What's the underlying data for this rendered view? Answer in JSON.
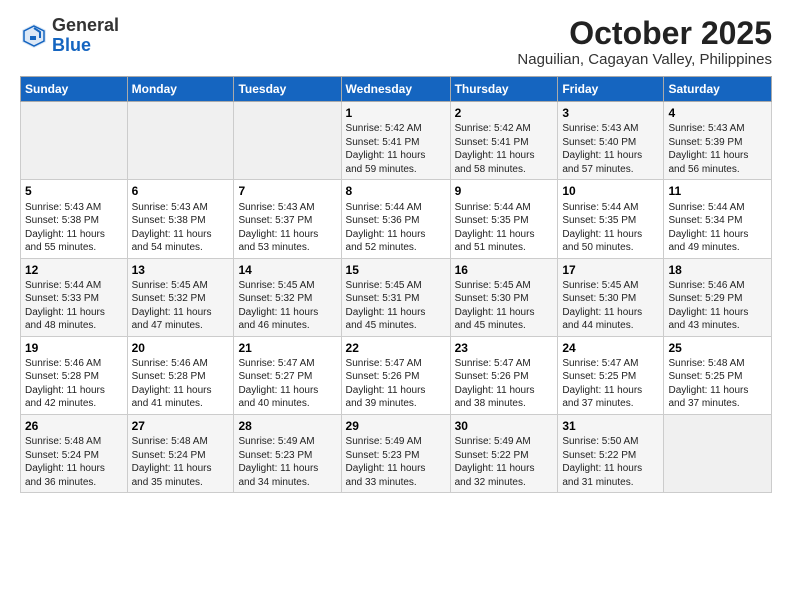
{
  "logo": {
    "general": "General",
    "blue": "Blue"
  },
  "header": {
    "month": "October 2025",
    "location": "Naguilian, Cagayan Valley, Philippines"
  },
  "weekdays": [
    "Sunday",
    "Monday",
    "Tuesday",
    "Wednesday",
    "Thursday",
    "Friday",
    "Saturday"
  ],
  "weeks": [
    [
      {
        "day": "",
        "info": ""
      },
      {
        "day": "",
        "info": ""
      },
      {
        "day": "",
        "info": ""
      },
      {
        "day": "1",
        "info": "Sunrise: 5:42 AM\nSunset: 5:41 PM\nDaylight: 11 hours\nand 59 minutes."
      },
      {
        "day": "2",
        "info": "Sunrise: 5:42 AM\nSunset: 5:41 PM\nDaylight: 11 hours\nand 58 minutes."
      },
      {
        "day": "3",
        "info": "Sunrise: 5:43 AM\nSunset: 5:40 PM\nDaylight: 11 hours\nand 57 minutes."
      },
      {
        "day": "4",
        "info": "Sunrise: 5:43 AM\nSunset: 5:39 PM\nDaylight: 11 hours\nand 56 minutes."
      }
    ],
    [
      {
        "day": "5",
        "info": "Sunrise: 5:43 AM\nSunset: 5:38 PM\nDaylight: 11 hours\nand 55 minutes."
      },
      {
        "day": "6",
        "info": "Sunrise: 5:43 AM\nSunset: 5:38 PM\nDaylight: 11 hours\nand 54 minutes."
      },
      {
        "day": "7",
        "info": "Sunrise: 5:43 AM\nSunset: 5:37 PM\nDaylight: 11 hours\nand 53 minutes."
      },
      {
        "day": "8",
        "info": "Sunrise: 5:44 AM\nSunset: 5:36 PM\nDaylight: 11 hours\nand 52 minutes."
      },
      {
        "day": "9",
        "info": "Sunrise: 5:44 AM\nSunset: 5:35 PM\nDaylight: 11 hours\nand 51 minutes."
      },
      {
        "day": "10",
        "info": "Sunrise: 5:44 AM\nSunset: 5:35 PM\nDaylight: 11 hours\nand 50 minutes."
      },
      {
        "day": "11",
        "info": "Sunrise: 5:44 AM\nSunset: 5:34 PM\nDaylight: 11 hours\nand 49 minutes."
      }
    ],
    [
      {
        "day": "12",
        "info": "Sunrise: 5:44 AM\nSunset: 5:33 PM\nDaylight: 11 hours\nand 48 minutes."
      },
      {
        "day": "13",
        "info": "Sunrise: 5:45 AM\nSunset: 5:32 PM\nDaylight: 11 hours\nand 47 minutes."
      },
      {
        "day": "14",
        "info": "Sunrise: 5:45 AM\nSunset: 5:32 PM\nDaylight: 11 hours\nand 46 minutes."
      },
      {
        "day": "15",
        "info": "Sunrise: 5:45 AM\nSunset: 5:31 PM\nDaylight: 11 hours\nand 45 minutes."
      },
      {
        "day": "16",
        "info": "Sunrise: 5:45 AM\nSunset: 5:30 PM\nDaylight: 11 hours\nand 45 minutes."
      },
      {
        "day": "17",
        "info": "Sunrise: 5:45 AM\nSunset: 5:30 PM\nDaylight: 11 hours\nand 44 minutes."
      },
      {
        "day": "18",
        "info": "Sunrise: 5:46 AM\nSunset: 5:29 PM\nDaylight: 11 hours\nand 43 minutes."
      }
    ],
    [
      {
        "day": "19",
        "info": "Sunrise: 5:46 AM\nSunset: 5:28 PM\nDaylight: 11 hours\nand 42 minutes."
      },
      {
        "day": "20",
        "info": "Sunrise: 5:46 AM\nSunset: 5:28 PM\nDaylight: 11 hours\nand 41 minutes."
      },
      {
        "day": "21",
        "info": "Sunrise: 5:47 AM\nSunset: 5:27 PM\nDaylight: 11 hours\nand 40 minutes."
      },
      {
        "day": "22",
        "info": "Sunrise: 5:47 AM\nSunset: 5:26 PM\nDaylight: 11 hours\nand 39 minutes."
      },
      {
        "day": "23",
        "info": "Sunrise: 5:47 AM\nSunset: 5:26 PM\nDaylight: 11 hours\nand 38 minutes."
      },
      {
        "day": "24",
        "info": "Sunrise: 5:47 AM\nSunset: 5:25 PM\nDaylight: 11 hours\nand 37 minutes."
      },
      {
        "day": "25",
        "info": "Sunrise: 5:48 AM\nSunset: 5:25 PM\nDaylight: 11 hours\nand 37 minutes."
      }
    ],
    [
      {
        "day": "26",
        "info": "Sunrise: 5:48 AM\nSunset: 5:24 PM\nDaylight: 11 hours\nand 36 minutes."
      },
      {
        "day": "27",
        "info": "Sunrise: 5:48 AM\nSunset: 5:24 PM\nDaylight: 11 hours\nand 35 minutes."
      },
      {
        "day": "28",
        "info": "Sunrise: 5:49 AM\nSunset: 5:23 PM\nDaylight: 11 hours\nand 34 minutes."
      },
      {
        "day": "29",
        "info": "Sunrise: 5:49 AM\nSunset: 5:23 PM\nDaylight: 11 hours\nand 33 minutes."
      },
      {
        "day": "30",
        "info": "Sunrise: 5:49 AM\nSunset: 5:22 PM\nDaylight: 11 hours\nand 32 minutes."
      },
      {
        "day": "31",
        "info": "Sunrise: 5:50 AM\nSunset: 5:22 PM\nDaylight: 11 hours\nand 31 minutes."
      },
      {
        "day": "",
        "info": ""
      }
    ]
  ]
}
